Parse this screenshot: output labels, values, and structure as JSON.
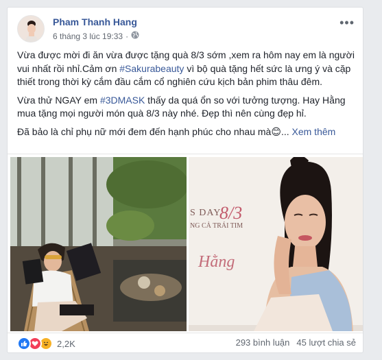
{
  "post": {
    "author": "Pham Thanh Hang",
    "timestamp": "6 tháng 3 lúc 19:33",
    "privacy_icon": "globe-icon",
    "more_icon": "more-options-icon",
    "text": {
      "p1_a": "Vừa được mời đi ăn vừa được tặng quà 8/3 sớm ,xem ra hôm nay em là người vui nhất rồi nhỉ.Cảm ơn ",
      "p1_tag": "#Sakurabeauty",
      "p1_b": " vì bộ quà tặng hết sức là ưng ý và cặp thiết trong thời kỳ cắm đầu cắm cổ nghiên cứu kịch bản phim thâu đêm.",
      "p2_a": "Vừa thử NGAY em ",
      "p2_tag": "#3DMASK",
      "p2_b": " thấy da quá ổn so với tưởng tượng. Hay Hằng mua tặng mọi người món quà 8/3 này nhé. Đẹp thì nên cùng đẹp hỉ.",
      "p3": "Đã bảo là chỉ phụ nữ mới đem đến hạnh phúc cho nhau mà😊...",
      "see_more": "Xem thêm"
    },
    "photo_right": {
      "line1": "S DAY",
      "line2": "NG CẢ TRÁI TIM",
      "num": "8/3",
      "script": "Hằng"
    }
  },
  "footer": {
    "reaction_icons": [
      "like-icon",
      "love-icon",
      "haha-icon"
    ],
    "reaction_count": "2,2K",
    "comments": "293 bình luận",
    "shares": "45 lượt chia sẻ"
  }
}
